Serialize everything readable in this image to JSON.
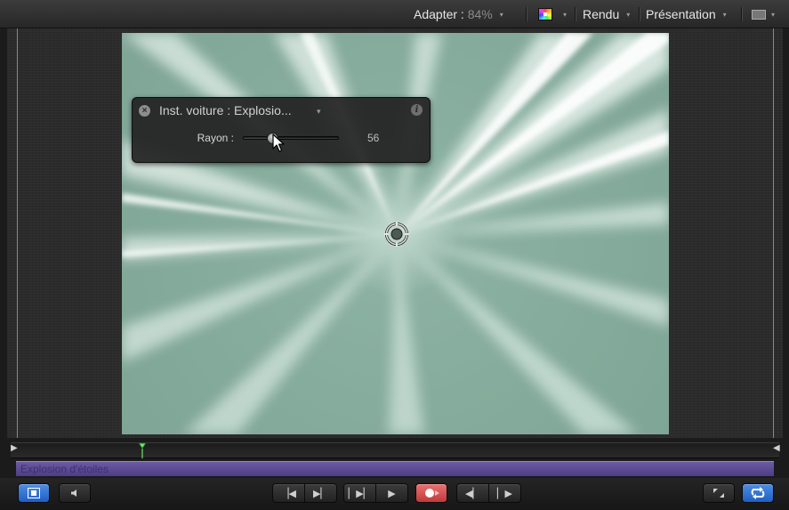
{
  "toolbar": {
    "fit_label": "Adapter : ",
    "fit_value": "84%",
    "render_label": "Rendu",
    "view_label": "Présentation",
    "caret": "▾",
    "color_icon": "color-channels-icon",
    "view_icon": "view-layout-icon"
  },
  "hud": {
    "close_glyph": "×",
    "title": "Inst. voiture : Explosio...",
    "caret": "▾",
    "info_glyph": "i",
    "param_label": "Rayon :",
    "param_value": "56",
    "param_level": 0.3
  },
  "timeline": {
    "in_marker": "◀",
    "out_marker": "▶",
    "clip_label": "Explosion d'étoiles"
  },
  "transport": {
    "go_start": "▕◀",
    "go_end": "▶▏",
    "play_from_start": "▏▶▏",
    "play": "▶",
    "prev_frame": "◀▏",
    "next_frame": "▏▶",
    "icons": {
      "player": "player-view-icon",
      "audio": "speaker-icon",
      "record": "record-icon",
      "fullscreen": "fullscreen-icon",
      "loop": "loop-icon"
    }
  },
  "colors": {
    "accent_blue": "#2f6fd0",
    "record_red": "#d04848",
    "clip_purple": "#5c4b93",
    "canvas_green": "#87ad9e"
  }
}
